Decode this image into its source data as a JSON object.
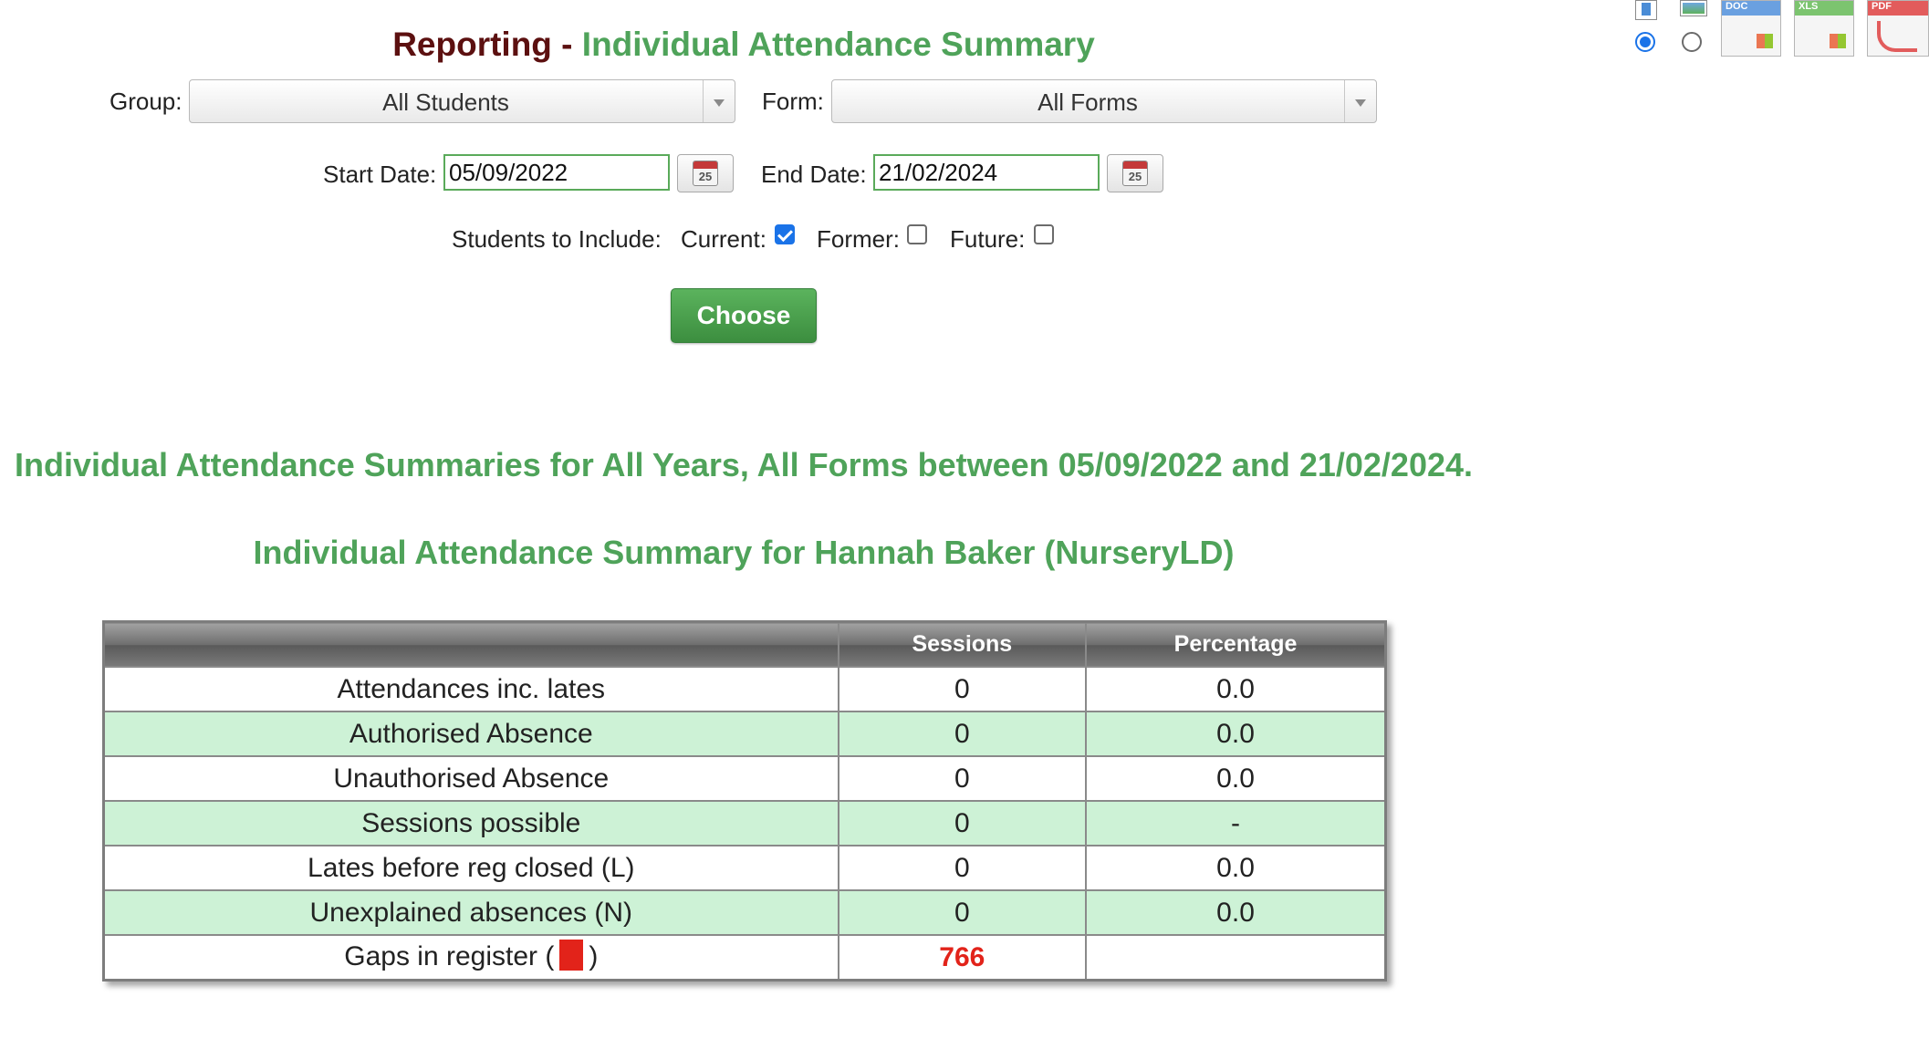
{
  "title": {
    "prefix": "Reporting -",
    "main": "Individual Attendance Summary"
  },
  "filters": {
    "group_label": "Group:",
    "group_value": "All Students",
    "form_label": "Form:",
    "form_value": "All Forms",
    "start_label": "Start Date:",
    "start_value": "05/09/2022",
    "end_label": "End Date:",
    "end_value": "21/02/2024",
    "calendar_day": "25",
    "include_label": "Students to Include:",
    "current_label": "Current:",
    "current_checked": true,
    "former_label": "Former:",
    "former_checked": false,
    "future_label": "Future:",
    "future_checked": false,
    "choose_label": "Choose"
  },
  "export": {
    "icons": [
      "portrait-icon",
      "landscape-icon",
      "doc-icon",
      "xls-icon",
      "pdf-icon"
    ],
    "doc_label": "DOC",
    "xls_label": "XLS",
    "pdf_label": "PDF",
    "orientation_selected": "portrait"
  },
  "report": {
    "heading": "Individual Attendance Summaries for All Years, All Forms between 05/09/2022 and 21/02/2024.",
    "subheading": "Individual Attendance Summary for Hannah Baker (NurseryLD)",
    "columns": [
      "",
      "Sessions",
      "Percentage"
    ],
    "rows": [
      {
        "label": "Attendances inc. lates",
        "sessions": "0",
        "percentage": "0.0"
      },
      {
        "label": "Authorised Absence",
        "sessions": "0",
        "percentage": "0.0"
      },
      {
        "label": "Unauthorised Absence",
        "sessions": "0",
        "percentage": "0.0"
      },
      {
        "label": "Sessions possible",
        "sessions": "0",
        "percentage": "-"
      },
      {
        "label": "Lates before reg closed (L)",
        "sessions": "0",
        "percentage": "0.0"
      },
      {
        "label": "Unexplained absences (N)",
        "sessions": "0",
        "percentage": "0.0"
      }
    ],
    "gaps": {
      "label_before": "Gaps in register (",
      "label_after": ")",
      "sessions": "766",
      "percentage": ""
    }
  },
  "colors": {
    "accent_green": "#4fa35a",
    "title_dark": "#5c1010",
    "row_alt": "#cdf2d6",
    "alert_red": "#e2231a",
    "checkbox_blue": "#1a73e8"
  }
}
